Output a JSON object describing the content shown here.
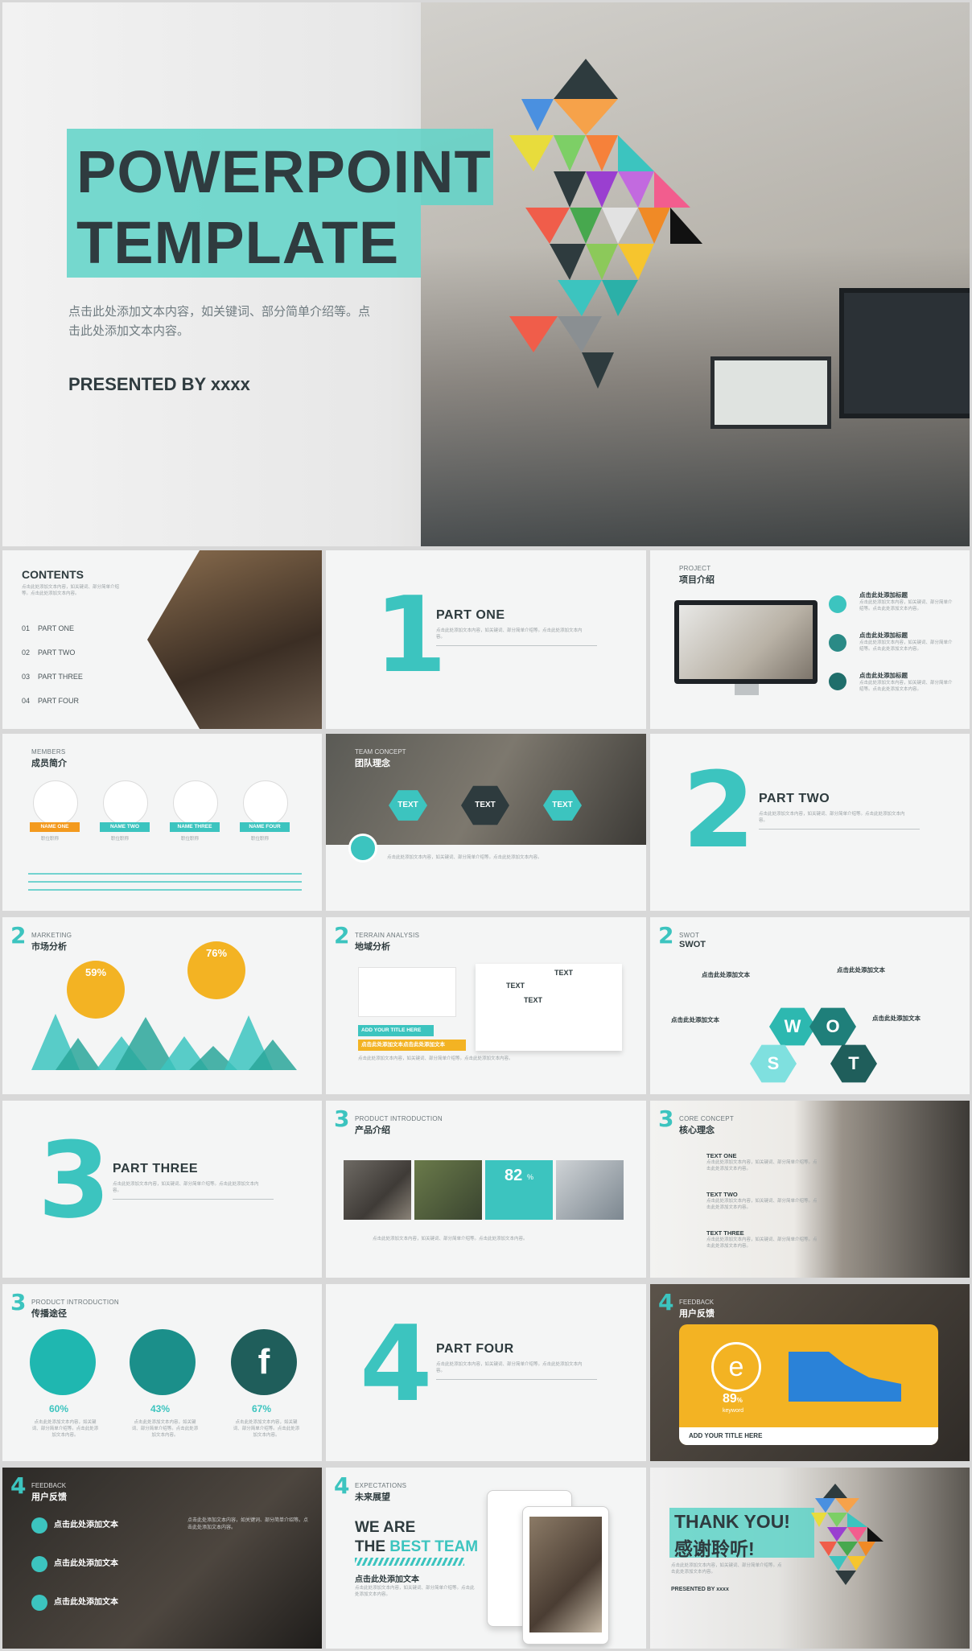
{
  "hero": {
    "title_line1": "POWERPOINT",
    "title_line2": "TEMPLATE",
    "subtitle": "点击此处添加文本内容，如关键词、部分简单介绍等。点击此处添加文本内容。",
    "presented_by": "PRESENTED BY xxxx"
  },
  "contents": {
    "title": "CONTENTS",
    "items": [
      {
        "num": "01",
        "label": "PART ONE"
      },
      {
        "num": "02",
        "label": "PART TWO"
      },
      {
        "num": "03",
        "label": "PART THREE"
      },
      {
        "num": "04",
        "label": "PART FOUR"
      }
    ]
  },
  "part_one": {
    "numeral": "1",
    "title": "PART ONE"
  },
  "project": {
    "en": "PROJECT",
    "cn": "项目介绍",
    "items": [
      "点击此处添加标题",
      "点击此处添加标题",
      "点击此处添加标题"
    ]
  },
  "members": {
    "en": "MEMBERS",
    "cn": "成员简介",
    "names": [
      "NAME ONE",
      "NAME TWO",
      "NAME THREE",
      "NAME FOUR"
    ],
    "role": "职位职称"
  },
  "team": {
    "en": "TEAM CONCEPT",
    "cn": "团队理念",
    "hexes": [
      "TEXT",
      "TEXT",
      "TEXT"
    ]
  },
  "part_two": {
    "numeral": "2",
    "title": "PART TWO"
  },
  "marketing": {
    "en": "MARKETING",
    "cn": "市场分析",
    "pct1": "59%",
    "pct2": "76%"
  },
  "terrain": {
    "en": "TERRAIN ANALYSIS",
    "cn": "地域分析",
    "btn": "ADD YOUR TITLE HERE",
    "bar": "点击此处添加文本点击此处添加文本",
    "map_labels": [
      "TEXT",
      "TEXT",
      "TEXT"
    ]
  },
  "swot": {
    "en": "SWOT",
    "cn": "SWOT",
    "letters": [
      "W",
      "O",
      "S",
      "T"
    ],
    "labels": [
      "点击此处添加文本",
      "点击此处添加文本",
      "点击此处添加文本",
      "点击此处添加文本"
    ]
  },
  "part_three": {
    "numeral": "3",
    "title": "PART THREE"
  },
  "product": {
    "en": "PRODUCT INTRODUCTION",
    "cn": "产品介绍",
    "pct": "82",
    "pct_unit": "%"
  },
  "core": {
    "en": "CORE CONCEPT",
    "cn": "核心理念",
    "items": [
      "TEXT ONE",
      "TEXT TWO",
      "TEXT THREE"
    ]
  },
  "channels": {
    "en": "PRODUCT INTRODUCTION",
    "cn": "传播途径",
    "values": [
      "60%",
      "43%",
      "67%"
    ]
  },
  "part_four": {
    "numeral": "4",
    "title": "PART FOUR"
  },
  "feedback1": {
    "en": "FEEDBACK",
    "cn": "用户反馈",
    "value": "89",
    "unit": "%",
    "keyword": "keyword",
    "btn": "ADD YOUR TITLE HERE"
  },
  "feedback2": {
    "en": "FEEDBACK",
    "cn": "用户反馈",
    "items": [
      "点击此处添加文本",
      "点击此处添加文本",
      "点击此处添加文本"
    ]
  },
  "expect": {
    "en": "EXPECTATIONS",
    "cn": "未来展望",
    "line1": "WE ARE",
    "line2a": "THE ",
    "line2b": "BEST TEAM",
    "sub": "点击此处添加文本"
  },
  "thanks": {
    "en": "THANK YOU!",
    "cn": "感谢聆听!",
    "presented_by": "PRESENTED BY xxxx"
  },
  "filler": "点击此处添加文本内容，如关键词、部分简单介绍等。点击此处添加文本内容。",
  "colors": {
    "teal": "#3cc4bf",
    "orange": "#f39a1e",
    "dark": "#2e3b3e",
    "yellow": "#f3b323"
  }
}
